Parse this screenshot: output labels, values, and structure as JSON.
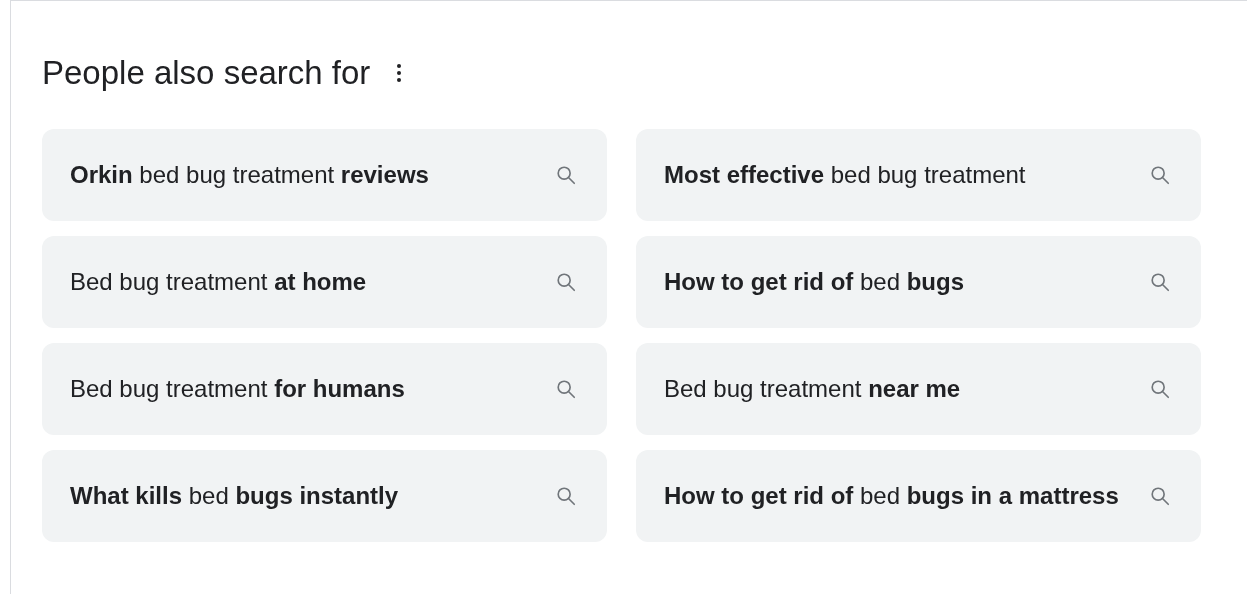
{
  "title": "People also search for",
  "suggestions": [
    {
      "text": "**Orkin** bed bug treatment **reviews**"
    },
    {
      "text": "**Most effective** bed bug treatment"
    },
    {
      "text": "Bed bug treatment **at home**"
    },
    {
      "text": "**How to get rid of** bed **bugs**"
    },
    {
      "text": "Bed bug treatment **for humans**"
    },
    {
      "text": "Bed bug treatment **near me**"
    },
    {
      "text": "**What kills** bed **bugs instantly**"
    },
    {
      "text": "**How to get rid of** bed **bugs in a mattress**"
    }
  ]
}
